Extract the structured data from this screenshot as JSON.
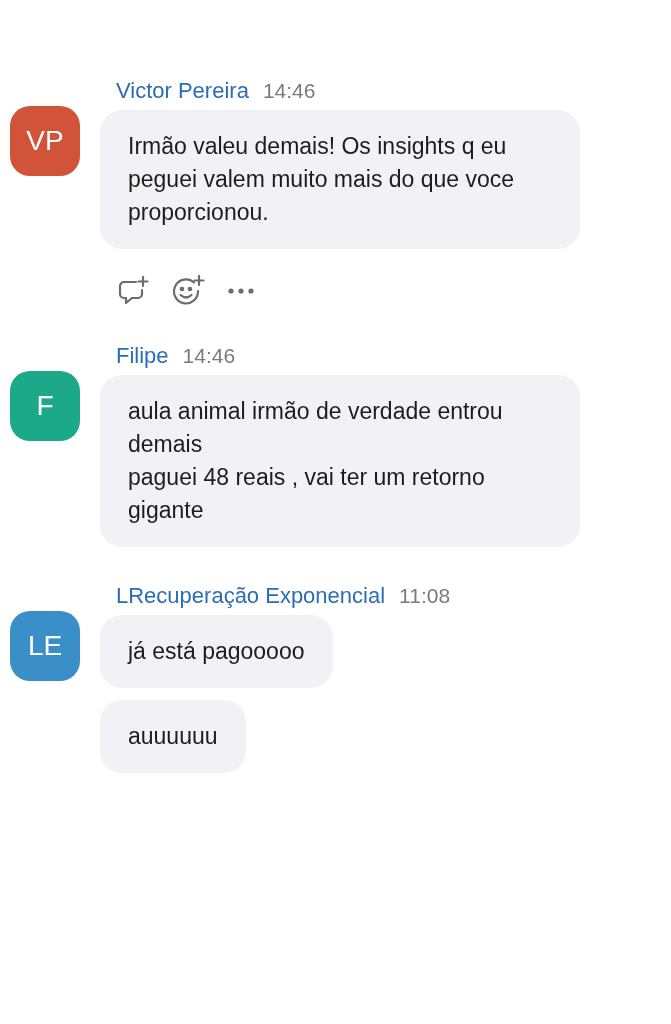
{
  "messages": [
    {
      "initials": "VP",
      "color": "#d0533a",
      "sender": "Victor Pereira",
      "time": "14:46",
      "bubbles": [
        "Irmão valeu demais! Os insights q eu peguei valem muito mais do que voce proporcionou."
      ],
      "actions": true
    },
    {
      "initials": "F",
      "color": "#1ba98a",
      "sender": "Filipe",
      "time": "14:46",
      "bubbles": [
        "aula animal irmão de verdade entrou demais\npaguei 48 reais , vai ter um retorno gigante"
      ],
      "actions": false
    },
    {
      "initials": "LE",
      "color": "#3b8fc9",
      "sender": "LRecuperação Exponencial",
      "time": "11:08",
      "bubbles": [
        "já está pagooooo",
        "auuuuuu"
      ],
      "actions": false
    }
  ]
}
